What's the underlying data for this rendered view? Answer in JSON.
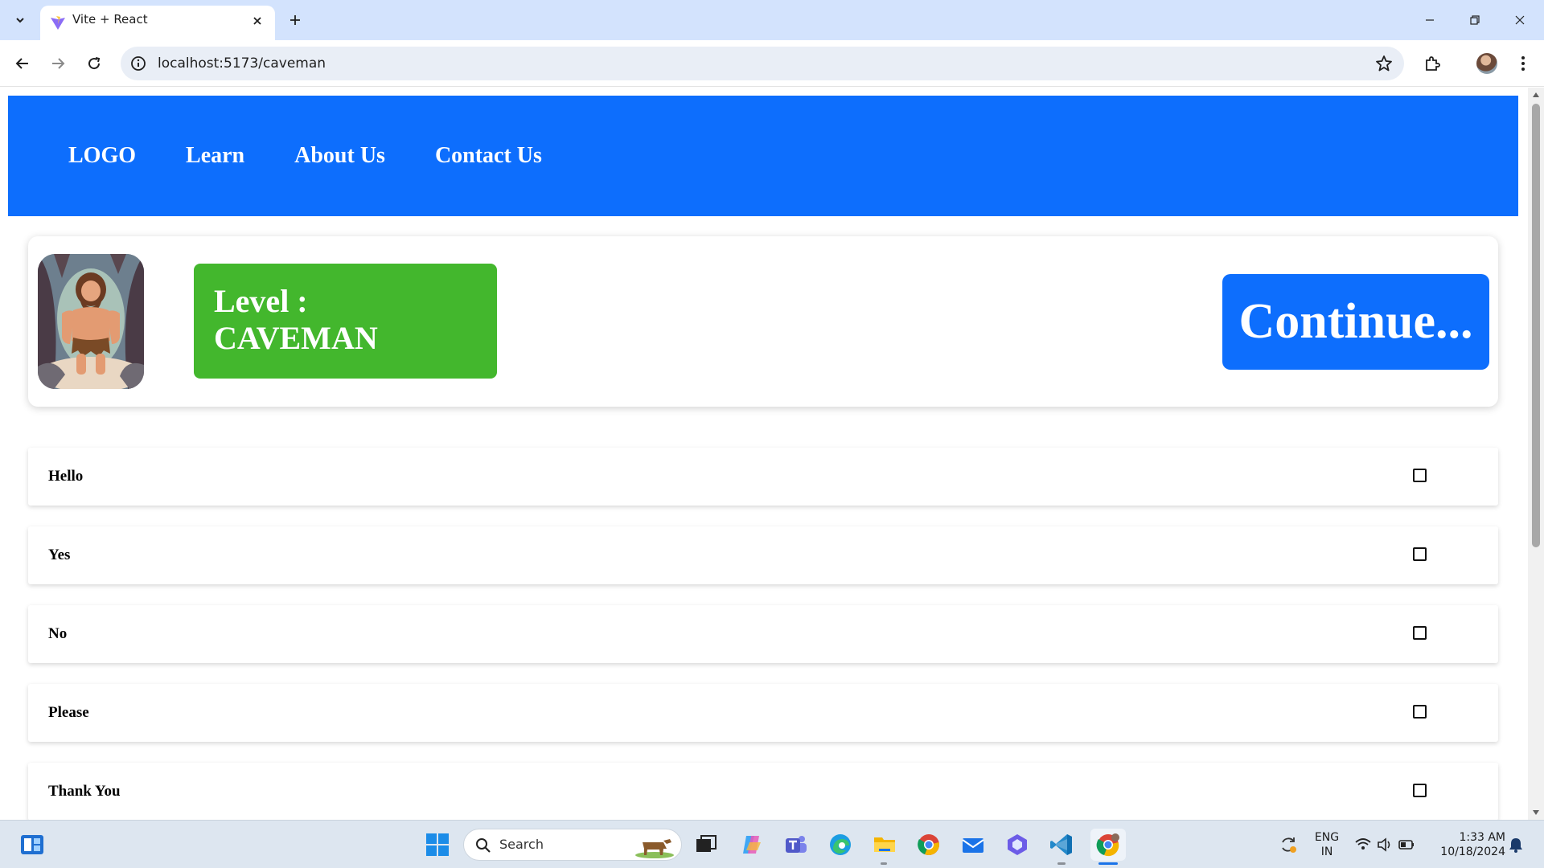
{
  "browser": {
    "tab_title": "Vite + React",
    "url": "localhost:5173/caveman"
  },
  "site": {
    "nav": [
      "LOGO",
      "Learn",
      "About Us",
      "Contact Us"
    ],
    "level_label": "Level :",
    "level_name": "CAVEMAN",
    "continue_label": "Continue...",
    "words": [
      {
        "label": "Hello",
        "checked": false
      },
      {
        "label": "Yes",
        "checked": false
      },
      {
        "label": "No",
        "checked": false
      },
      {
        "label": "Please",
        "checked": false
      },
      {
        "label": "Thank You",
        "checked": false
      }
    ]
  },
  "taskbar": {
    "search_placeholder": "Search",
    "lang_top": "ENG",
    "lang_bottom": "IN",
    "time": "1:33 AM",
    "date": "10/18/2024"
  },
  "colors": {
    "nav_blue": "#0d6efd",
    "level_green": "#43b72d",
    "tab_strip": "#d3e3fd"
  }
}
